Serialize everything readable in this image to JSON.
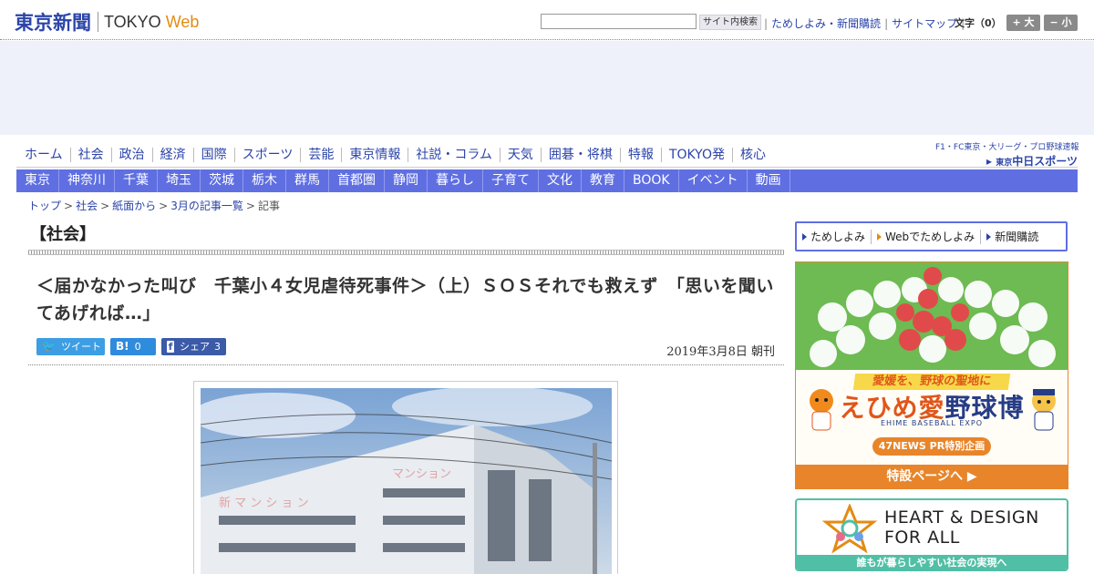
{
  "header": {
    "logo_jp": "東京新聞",
    "logo_en_prefix": "TOKYO ",
    "logo_en_suffix": "Web",
    "search_placeholder": "",
    "search_button": "サイト内検索",
    "util_links": [
      "ためしよみ・新聞購読",
      "サイトマップ"
    ],
    "fontsize_label": "文字（0）",
    "fontsize_bigger": "+ 大",
    "fontsize_smaller": "− 小"
  },
  "main_nav": [
    "ホーム",
    "社会",
    "政治",
    "経済",
    "国際",
    "スポーツ",
    "芸能",
    "東京情報",
    "社説・コラム",
    "天気",
    "囲碁・将棋",
    "特報",
    "TOKYO発",
    "核心"
  ],
  "sports_promo": {
    "top": "F1・FC東京・大リーグ・プロ野球速報",
    "logo_small": "東京",
    "logo": "中日スポーツ"
  },
  "region_nav": [
    "東京",
    "神奈川",
    "千葉",
    "埼玉",
    "茨城",
    "栃木",
    "群馬",
    "首都圏",
    "静岡",
    "暮らし",
    "子育て",
    "文化",
    "教育",
    "BOOK",
    "イベント",
    "動画"
  ],
  "breadcrumb": [
    "トップ",
    "社会",
    "紙面から",
    "3月の記事一覧"
  ],
  "breadcrumb_current": "記事",
  "article": {
    "section": "【社会】",
    "headline": "＜届かなかった叫び　千葉小４女児虐待死事件＞（上）ＳＯＳそれでも救えず　「思いを聞いてあげれば…」",
    "date": "2019年3月8日 朝刊",
    "share": {
      "tweet_icon": "🐦",
      "tweet_label": "ツイート",
      "hatena_icon": "B!",
      "hatena_count": "0",
      "fb_icon": "f",
      "fb_label": "シェア",
      "fb_count": "3"
    }
  },
  "sidebar": {
    "links": [
      "ためしよみ",
      "Webでためしよみ",
      "新聞購読"
    ],
    "ad_ehime": {
      "tagline": "愛媛を、野球の聖地に",
      "title_a": "えひめ",
      "title_b": "愛",
      "title_c": "野球博",
      "subtitle": "EHIME BASEBALL EXPO",
      "pill": "47NEWS PR特別企画",
      "footer": "特設ページへ ▶"
    },
    "ad_heart": {
      "line1": "HEART & DESIGN",
      "line2": "FOR ALL",
      "footer": "誰もが暮らしやすい社会の実現へ"
    }
  },
  "colors": {
    "brand_blue": "#2b44a8",
    "region_nav_bg": "#5f6fe2",
    "accent_orange": "#e38b12",
    "heart_green": "#51bfa6"
  }
}
